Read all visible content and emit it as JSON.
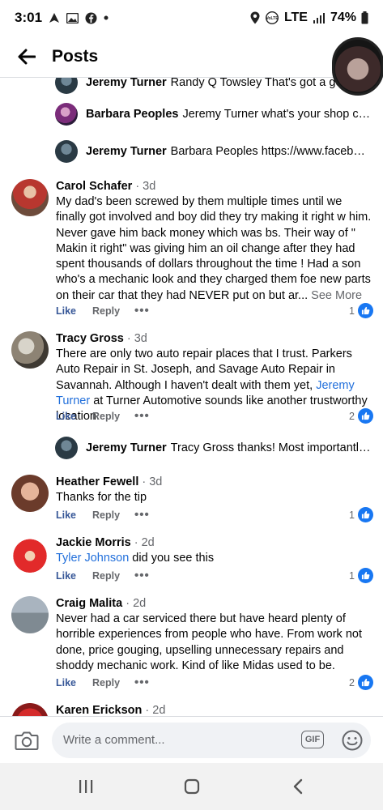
{
  "status": {
    "time": "3:01",
    "network": "LTE",
    "battery": "74%"
  },
  "header": {
    "title": "Posts"
  },
  "top_partial_reply": {
    "name": "Jeremy Turner",
    "text": "Randy Q Towsley  That's got a go"
  },
  "replies_top": [
    {
      "name": "Barbara Peoples",
      "text": "Jeremy Turner what's your shop call..."
    },
    {
      "name": "Jeremy Turner",
      "text": "Barbara Peoples https://www.faceboo..."
    }
  ],
  "comments": [
    {
      "name": "Carol Schafer",
      "time": "· 3d",
      "text": "My dad's been screwed by them multiple times until we finally got involved and boy did they try making it right w him.  Never gave him back money which was bs.  Their way of \" Makin it right\" was giving him an oil change after they had spent thousands of dollars throughout the time ! Had a son who's a mechanic look and they charged them foe new parts on their car that they had NEVER put on but ar...",
      "see_more": " See More",
      "like": "Like",
      "reply": "Reply",
      "more": "•••",
      "reactions": "1"
    },
    {
      "name": "Tracy Gross",
      "time": "· 3d",
      "text_before": "There are only two auto repair places that I trust. Parkers Auto Repair in St. Joseph, and Savage Auto Repair in Savannah. Although I haven't dealt with them yet, ",
      "mention": "Jeremy Turner",
      "text_after": " at Turner Automotive sounds like another trustworthy location.",
      "like": "Like",
      "reply": "Reply",
      "more": "•••",
      "reactions": "2"
    },
    {
      "name": "Heather Fewell",
      "time": "· 3d",
      "text": "Thanks for the tip",
      "like": "Like",
      "reply": "Reply",
      "more": "•••",
      "reactions": "1"
    },
    {
      "name": "Jackie Morris",
      "time": "· 2d",
      "mention": "Tyler Johnson",
      "text_after": " did you see this",
      "like": "Like",
      "reply": "Reply",
      "more": "•••",
      "reactions": "1"
    },
    {
      "name": "Craig Malita",
      "time": "· 2d",
      "text": "Never had a car serviced there but have heard plenty of horrible experiences from people who have. From work not done, price gouging, upselling unnecessary repairs and shoddy mechanic work. Kind of like Midas used to be.",
      "like": "Like",
      "reply": "Reply",
      "more": "•••",
      "reactions": "2"
    },
    {
      "name": "Karen Erickson",
      "time": "· 2d"
    }
  ],
  "reply_tracy": {
    "name": "Jeremy Turner",
    "text": "Tracy Gross thanks!  Most importantly..."
  },
  "composer": {
    "placeholder": "Write a comment...",
    "gif": "GIF"
  },
  "icons": {
    "back": "back-arrow-icon",
    "camera": "camera-icon",
    "emoji": "emoji-icon",
    "like_badge": "thumbs-up-icon"
  },
  "colors": {
    "accent": "#1877f2",
    "mention": "#216fdb",
    "muted": "#65676b"
  }
}
